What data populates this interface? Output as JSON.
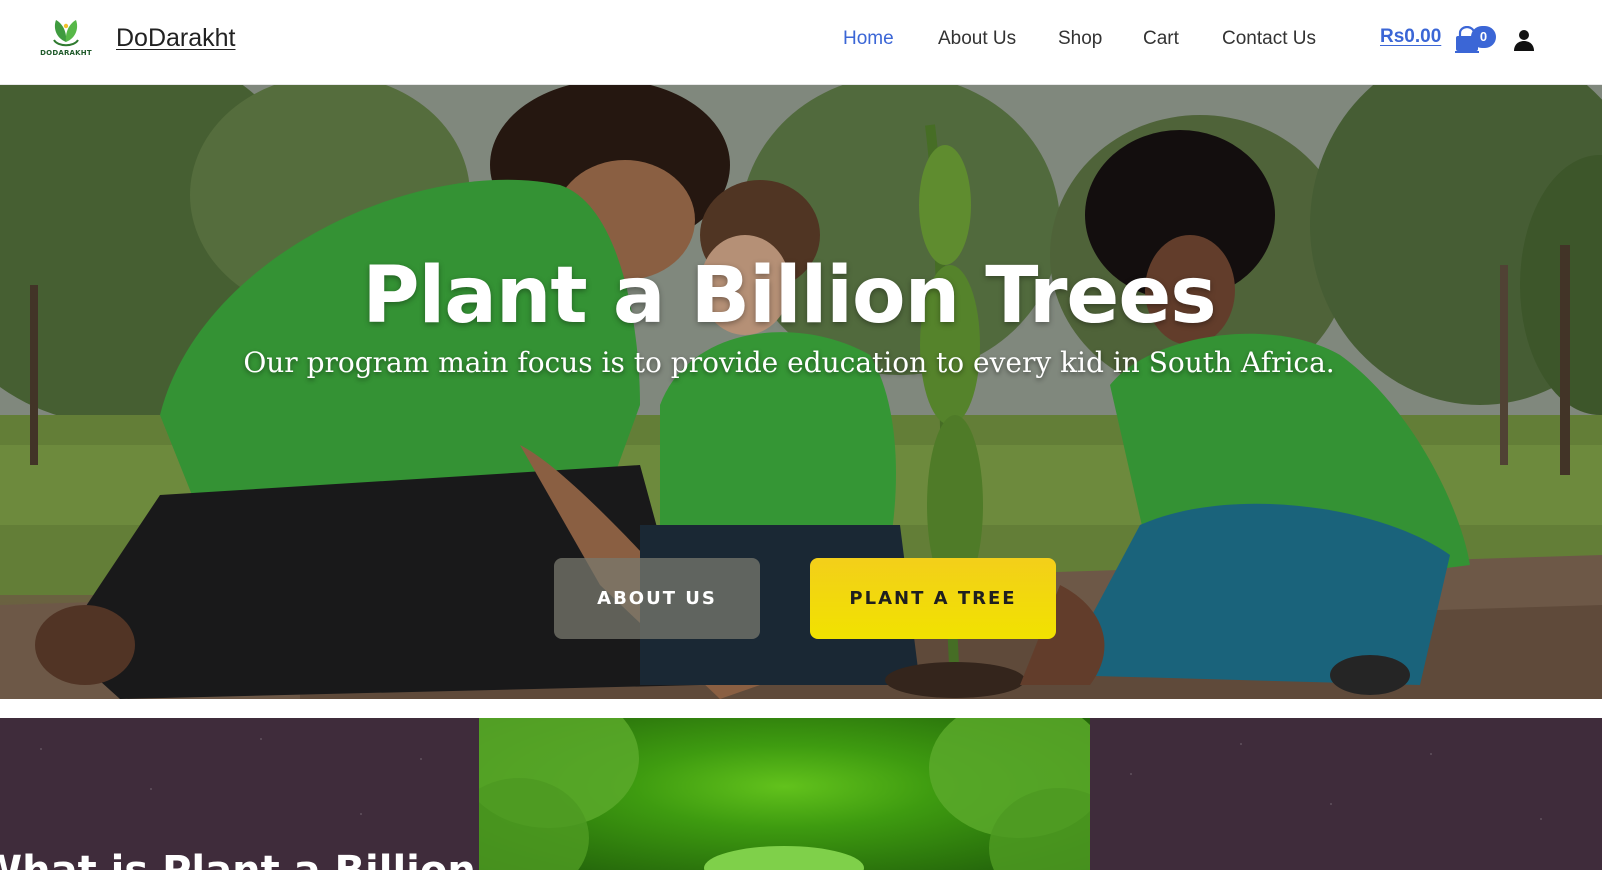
{
  "header": {
    "logo_caption": "DODARAKHT",
    "brand_name": "DoDarakht",
    "nav": [
      {
        "label": "Home",
        "active": true
      },
      {
        "label": "About Us",
        "active": false
      },
      {
        "label": "Shop",
        "active": false
      },
      {
        "label": "Cart",
        "active": false
      },
      {
        "label": "Contact Us",
        "active": false
      }
    ],
    "cart_total": "Rs0.00",
    "cart_count": "0",
    "icons": {
      "cart": "shopping-bag-icon",
      "account": "user-icon",
      "logo": "leaf-logo-icon"
    }
  },
  "hero": {
    "title": "Plant a Billion Trees",
    "subtitle": "Our program main focus is to provide education to every kid in South Africa.",
    "buttons": {
      "about": "ABOUT US",
      "plant": "PLANT A TREE"
    }
  },
  "section": {
    "heading": "What is Plant a Billion"
  },
  "colors": {
    "accent": "#3b66d6",
    "plant_button": "#f1e200",
    "section_bg": "#3f2c3b",
    "shirt_green": "#3aa33a"
  }
}
